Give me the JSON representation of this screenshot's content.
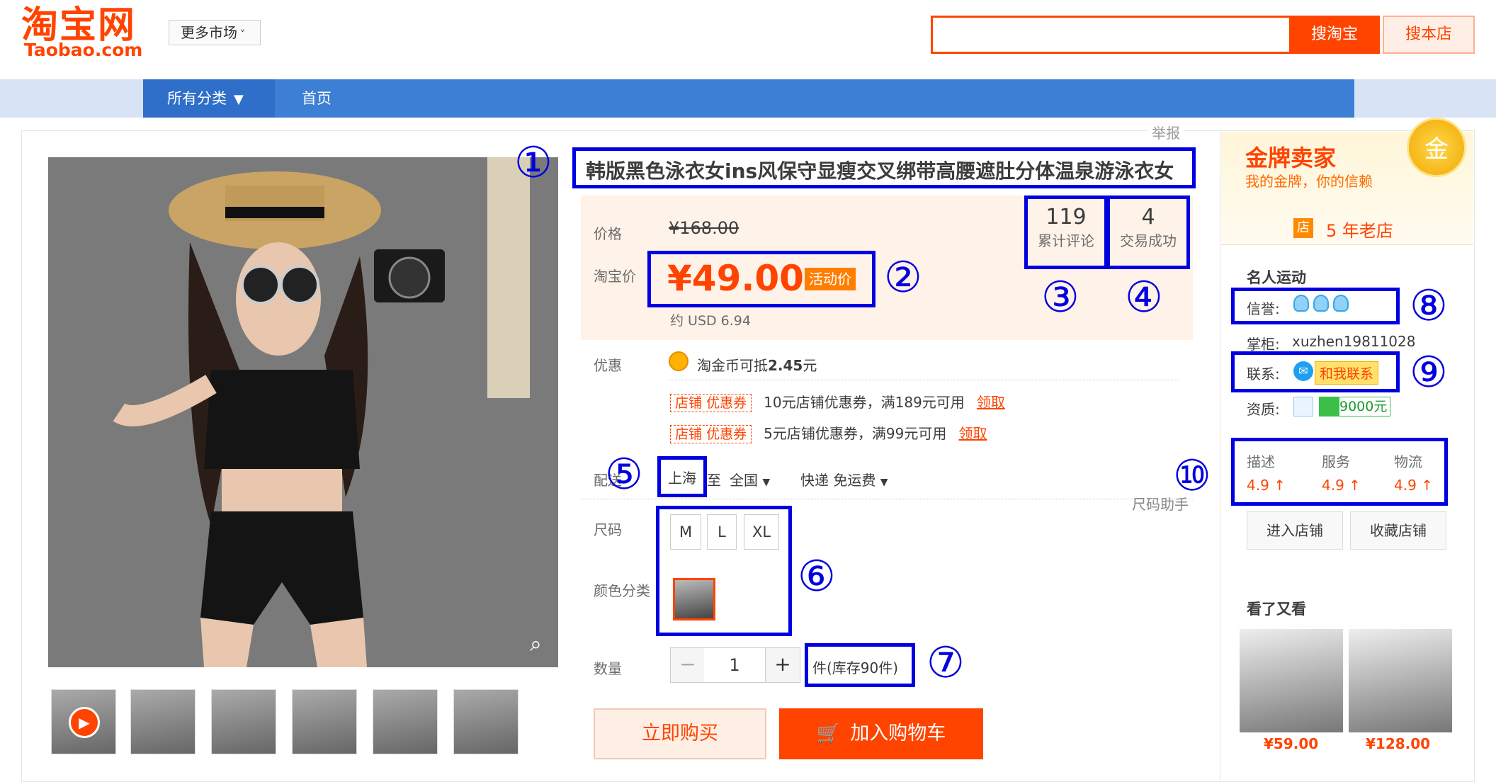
{
  "header": {
    "logo_text": "淘宝网",
    "logo_sub": "Taobao.com",
    "more_markets": "更多市场",
    "search_placeholder": "",
    "search_taobao": "搜淘宝",
    "search_shop": "搜本店"
  },
  "nav": {
    "all_categories": "所有分类",
    "home": "首页"
  },
  "report": "举报",
  "product": {
    "title": "韩版黑色泳衣女ins风保守显瘦交叉绑带高腰遮肚分体温泉游泳衣女",
    "price_label": "价格",
    "original_price": "¥168.00",
    "taobao_price_label": "淘宝价",
    "taobao_price": "¥49.00",
    "promo_tag": "活动价",
    "usd": "约 USD 6.94",
    "reviews_count": "119",
    "reviews_label": "累计评论",
    "sales_count": "4",
    "sales_label": "交易成功",
    "discount_label": "优惠",
    "coin_text_prefix": "淘金币可抵",
    "coin_amount": "2.45",
    "coin_unit": "元",
    "coupons": [
      {
        "tag_a": "店铺",
        "tag_b": "优惠券",
        "desc": "10元店铺优惠券，满189元可用",
        "claim": "领取"
      },
      {
        "tag_a": "店铺",
        "tag_b": "优惠券",
        "desc": "5元店铺优惠券，满99元可用",
        "claim": "领取"
      }
    ],
    "delivery_label": "配送",
    "delivery_from": "上海",
    "delivery_to_word": "至",
    "delivery_to": "全国",
    "delivery_method": "快递 免运费",
    "size_helper": "尺码助手",
    "size_label": "尺码",
    "sizes": [
      "M",
      "L",
      "XL"
    ],
    "color_label": "颜色分类",
    "qty_label": "数量",
    "qty_value": "1",
    "qty_minus": "−",
    "qty_plus": "+",
    "stock": "件(库存90件)",
    "buy_now": "立即购买",
    "add_cart": "加入购物车"
  },
  "seller": {
    "gold_title": "金牌卖家",
    "gold_sub": "我的金牌，你的信赖",
    "medal": "金",
    "shop_badge": "店",
    "shop_age": "5 年老店",
    "shop_name": "名人运动",
    "credit_label": "信誉:",
    "keeper_label": "掌柜:",
    "keeper_name": "xuzhen19811028",
    "contact_label": "联系:",
    "contact_btn": "和我联系",
    "qual_label": "资质:",
    "deposit": "9000元",
    "scores": [
      {
        "label": "描述",
        "value": "4.9 ↑"
      },
      {
        "label": "服务",
        "value": "4.9 ↑"
      },
      {
        "label": "物流",
        "value": "4.9 ↑"
      }
    ],
    "enter_shop": "进入店铺",
    "fav_shop": "收藏店铺",
    "also_viewed": "看了又看",
    "also_prices": [
      "¥59.00",
      "¥128.00"
    ]
  },
  "annotations": [
    "①",
    "②",
    "③",
    "④",
    "⑤",
    "⑥",
    "⑦",
    "⑧",
    "⑨",
    "⑩"
  ],
  "colors": {
    "brand": "#ff4400",
    "annotation": "#0000e0",
    "nav": "#3d7fd4"
  }
}
